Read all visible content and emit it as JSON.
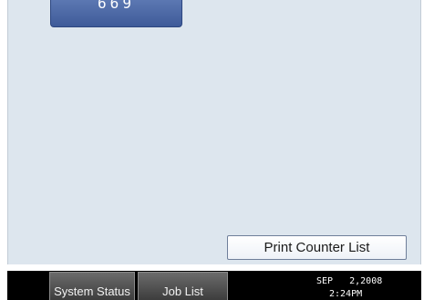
{
  "counter": {
    "value": "669"
  },
  "main": {
    "print_counter_list_label": "Print Counter List"
  },
  "status_bar": {
    "system_status_label": "System Status",
    "job_list_label": "Job List",
    "date": "SEP   2,2008",
    "time": "2:24PM"
  },
  "colors": {
    "panel_background": "#dde6ee",
    "counter_tab": "#4a67a3",
    "status_bar": "#000000"
  }
}
